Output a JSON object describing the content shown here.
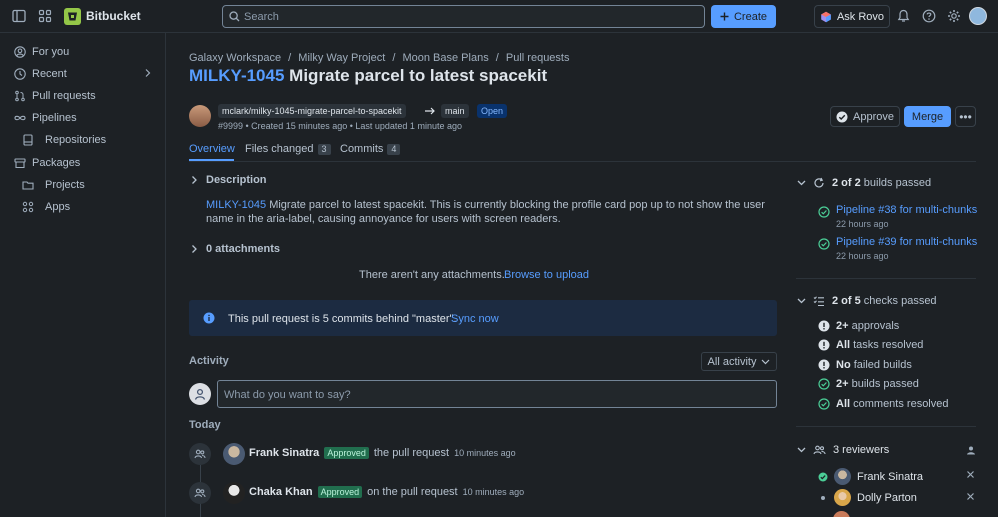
{
  "topbar": {
    "brand": "Bitbucket",
    "search_placeholder": "Search",
    "create_label": "Create",
    "ask_rovo_label": "Ask Rovo",
    "icons": [
      "sidebar-toggle-icon",
      "app-switcher-icon",
      "bitbucket-logo-icon",
      "search-icon",
      "plus-icon",
      "rovo-icon",
      "bell-icon",
      "help-icon",
      "gear-icon",
      "avatar"
    ]
  },
  "sidebar": {
    "items": [
      {
        "label": "For you",
        "icon": "person-circle-icon"
      },
      {
        "label": "Recent",
        "icon": "clock-icon"
      },
      {
        "label": "Pull requests",
        "icon": "pull-request-icon"
      },
      {
        "label": "Pipelines",
        "icon": "infinity-icon"
      },
      {
        "label": "Repositories",
        "icon": "repository-icon"
      },
      {
        "label": "Packages",
        "icon": "package-icon"
      },
      {
        "label": "Projects",
        "icon": "folder-icon"
      },
      {
        "label": "Apps",
        "icon": "apps-grid-icon"
      }
    ]
  },
  "breadcrumb": [
    "Galaxy Workspace",
    "Milky Way Project",
    "Moon Base Plans",
    "Pull requests"
  ],
  "breadcrumb_sep": "/",
  "pr": {
    "key": "MILKY-1045",
    "title": "Migrate parcel to latest spacekit",
    "source_branch": "mclark/milky-1045-migrate-parcel-to-spacekit",
    "target_branch": "main",
    "status": "Open",
    "meta": "#9999 • Created 15 minutes ago • Last updated 1 minute ago",
    "approve_label": "Approve",
    "merge_label": "Merge",
    "more_label": "•••"
  },
  "tabs": [
    {
      "label": "Overview",
      "count": ""
    },
    {
      "label": "Files changed",
      "count": "3"
    },
    {
      "label": "Commits",
      "count": "4"
    }
  ],
  "description": {
    "heading": "Description",
    "key": "MILKY-1045",
    "text": " Migrate parcel to latest spacekit. This is currently blocking the profile card pop up to not show the user name in the aria-label, causing annoyance for users with screen readers."
  },
  "attachments": {
    "heading": "0 attachments",
    "empty_text": "There aren't any attachments.",
    "upload_link": "Browse to upload"
  },
  "banner": {
    "text": "This pull request is 5 commits behind \"master\".",
    "link": "Sync now",
    "color": "#1c2b41"
  },
  "activity": {
    "heading": "Activity",
    "filter_label": "All activity",
    "comment_placeholder": "What do you want to say?",
    "today_label": "Today",
    "events": [
      {
        "user": "Frank Sinatra",
        "badge": "Approved",
        "action": "the pull request",
        "time": "10 minutes ago"
      },
      {
        "user": "Chaka Khan",
        "badge": "Approved",
        "action": "on the pull request",
        "time": "10 minutes ago"
      }
    ]
  },
  "builds": {
    "summary_bold": "2 of 2",
    "summary_rest": " builds passed",
    "items": [
      {
        "label": "Pipeline #38 for multi-chunks",
        "time": "22 hours ago"
      },
      {
        "label": "Pipeline #39 for multi-chunks",
        "time": "22 hours ago"
      }
    ]
  },
  "checks": {
    "summary_bold": "2 of 5",
    "summary_rest": " checks passed",
    "items": [
      {
        "bold": "2+",
        "rest": " approvals",
        "state": "warning"
      },
      {
        "bold": "All",
        "rest": " tasks resolved",
        "state": "warning"
      },
      {
        "bold": "No",
        "rest": " failed builds",
        "state": "warning"
      },
      {
        "bold": "2+",
        "rest": " builds passed",
        "state": "success"
      },
      {
        "bold": "All",
        "rest": " comments resolved",
        "state": "success"
      }
    ]
  },
  "reviewers": {
    "heading": "3 reviewers",
    "items": [
      {
        "name": "Frank Sinatra",
        "approved": true
      },
      {
        "name": "Dolly Parton",
        "approved": false
      }
    ]
  },
  "colors": {
    "accent": "#579dff",
    "success": "#4bce97",
    "background": "#1d2125"
  }
}
